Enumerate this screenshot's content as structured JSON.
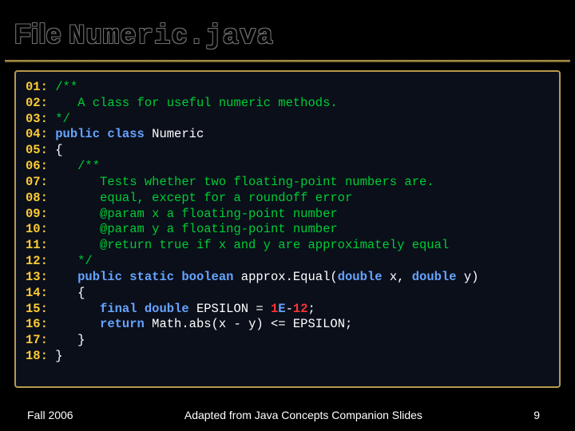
{
  "title": {
    "word1": "File",
    "word2": "Numeric.java"
  },
  "code": {
    "lines": [
      {
        "ln": "01:",
        "parts": [
          {
            "t": " ",
            "c": "pl"
          },
          {
            "t": "/**",
            "c": "cm"
          }
        ]
      },
      {
        "ln": "02:",
        "parts": [
          {
            "t": "    ",
            "c": "pl"
          },
          {
            "t": "A class for useful numeric methods.",
            "c": "cm"
          }
        ]
      },
      {
        "ln": "03:",
        "parts": [
          {
            "t": " ",
            "c": "pl"
          },
          {
            "t": "*/",
            "c": "cm"
          }
        ]
      },
      {
        "ln": "04:",
        "parts": [
          {
            "t": " ",
            "c": "pl"
          },
          {
            "t": "public class ",
            "c": "kw"
          },
          {
            "t": "Numeric",
            "c": "pl"
          }
        ]
      },
      {
        "ln": "05:",
        "parts": [
          {
            "t": " {",
            "c": "pl"
          }
        ]
      },
      {
        "ln": "06:",
        "parts": [
          {
            "t": "    ",
            "c": "pl"
          },
          {
            "t": "/**",
            "c": "cm"
          }
        ]
      },
      {
        "ln": "07:",
        "parts": [
          {
            "t": "       ",
            "c": "pl"
          },
          {
            "t": "Tests whether two floating-point numbers are.",
            "c": "cm"
          }
        ]
      },
      {
        "ln": "08:",
        "parts": [
          {
            "t": "       ",
            "c": "pl"
          },
          {
            "t": "equal, except for a roundoff error",
            "c": "cm"
          }
        ]
      },
      {
        "ln": "09:",
        "parts": [
          {
            "t": "       ",
            "c": "pl"
          },
          {
            "t": "@param x a floating-point number",
            "c": "cm"
          }
        ]
      },
      {
        "ln": "10:",
        "parts": [
          {
            "t": "       ",
            "c": "pl"
          },
          {
            "t": "@param y a floating-point number",
            "c": "cm"
          }
        ]
      },
      {
        "ln": "11:",
        "parts": [
          {
            "t": "       ",
            "c": "pl"
          },
          {
            "t": "@return true if x and y are approximately equal",
            "c": "cm"
          }
        ]
      },
      {
        "ln": "12:",
        "parts": [
          {
            "t": "    ",
            "c": "pl"
          },
          {
            "t": "*/",
            "c": "cm"
          }
        ]
      },
      {
        "ln": "13:",
        "parts": [
          {
            "t": "    ",
            "c": "pl"
          },
          {
            "t": "public static boolean ",
            "c": "kw"
          },
          {
            "t": "approx.Equal(",
            "c": "pl"
          },
          {
            "t": "double ",
            "c": "kw"
          },
          {
            "t": "x, ",
            "c": "pl"
          },
          {
            "t": "double ",
            "c": "kw"
          },
          {
            "t": "y)",
            "c": "pl"
          }
        ]
      },
      {
        "ln": "14:",
        "parts": [
          {
            "t": "    {",
            "c": "pl"
          }
        ]
      },
      {
        "ln": "15:",
        "parts": [
          {
            "t": "       ",
            "c": "pl"
          },
          {
            "t": "final double ",
            "c": "kw"
          },
          {
            "t": "EPSILON = ",
            "c": "pl"
          },
          {
            "t": "1",
            "c": "num"
          },
          {
            "t": "E",
            "c": "numE"
          },
          {
            "t": "-",
            "c": "pl"
          },
          {
            "t": "12",
            "c": "num"
          },
          {
            "t": ";",
            "c": "pl"
          }
        ]
      },
      {
        "ln": "16:",
        "parts": [
          {
            "t": "       ",
            "c": "pl"
          },
          {
            "t": "return ",
            "c": "kw"
          },
          {
            "t": "Math.abs(x - y) <= EPSILON;",
            "c": "pl"
          }
        ]
      },
      {
        "ln": "17:",
        "parts": [
          {
            "t": "    }",
            "c": "pl"
          }
        ]
      },
      {
        "ln": "18:",
        "parts": [
          {
            "t": " }",
            "c": "pl"
          }
        ]
      }
    ]
  },
  "footer": {
    "left": "Fall 2006",
    "center": "Adapted from Java Concepts Companion Slides",
    "right": "9"
  }
}
